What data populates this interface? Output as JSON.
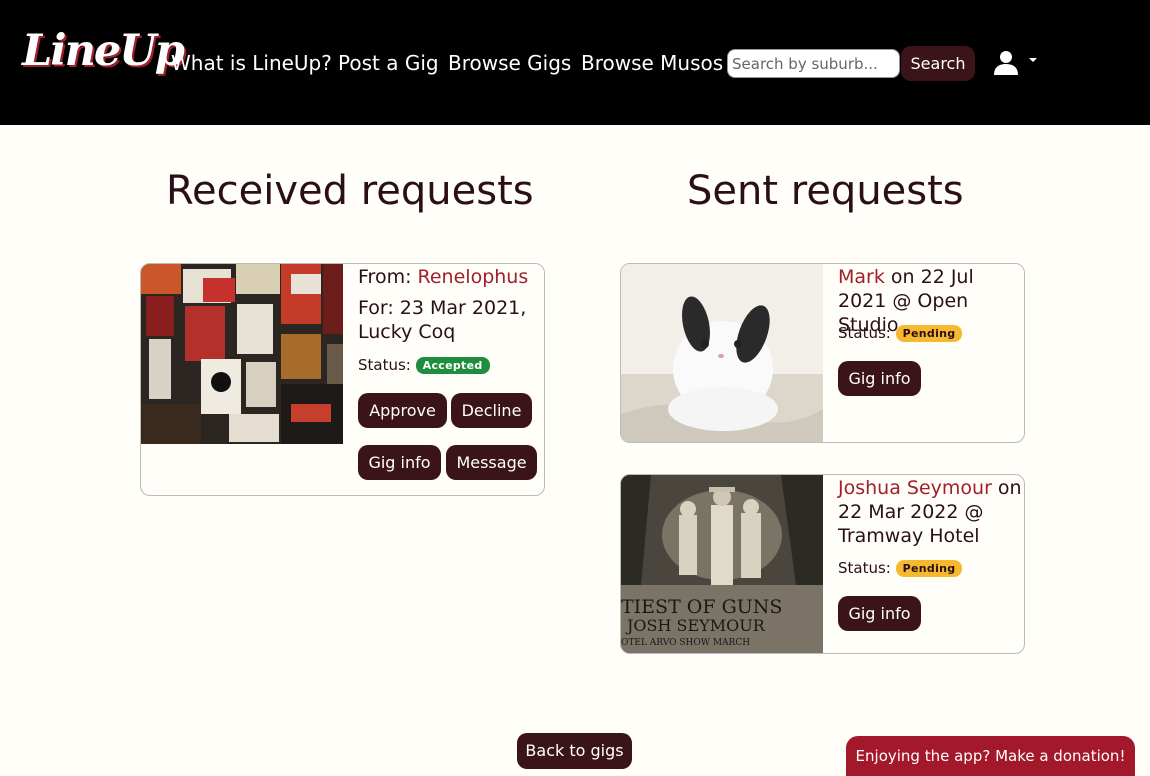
{
  "navbar": {
    "logo": "LineUp",
    "links": [
      "What is LineUp?",
      "Post a Gig",
      "Browse Gigs",
      "Browse Musos"
    ],
    "search_placeholder": "Search by suburb...",
    "search_label": "Search"
  },
  "received": {
    "title": "Received requests",
    "cards": [
      {
        "from_prefix": "From: ",
        "from_name": "Renelophus",
        "for_text": "For: 23 Mar 2021, Lucky Coq",
        "status_label": "Status:",
        "status": "Accepted",
        "approve": "Approve",
        "decline": "Decline",
        "gig_info": "Gig info",
        "message": "Message"
      }
    ]
  },
  "sent": {
    "title": "Sent requests",
    "cards": [
      {
        "name": "Mark",
        "detail": " on 22 Jul 2021 @ Open Studio",
        "status_label": "Status:",
        "status": "Pending",
        "gig_info": "Gig info"
      },
      {
        "name": "Joshua Seymour",
        "detail": " on 22 Mar 2022 @ Tramway Hotel",
        "status_label": "Status:",
        "status": "Pending",
        "gig_info": "Gig info",
        "poster_lines": [
          "TIEST OF GUNS",
          "JOSH  SEYMOUR",
          "OTEL  ARVO  SHOW  MARCH"
        ]
      }
    ]
  },
  "footer": {
    "back": "Back to gigs",
    "donate": "Enjoying the app? Make a donation!"
  },
  "colors": {
    "accent": "#a0202a",
    "button": "#3a1419",
    "accepted": "#1e8e3e",
    "pending": "#f5b82e"
  }
}
